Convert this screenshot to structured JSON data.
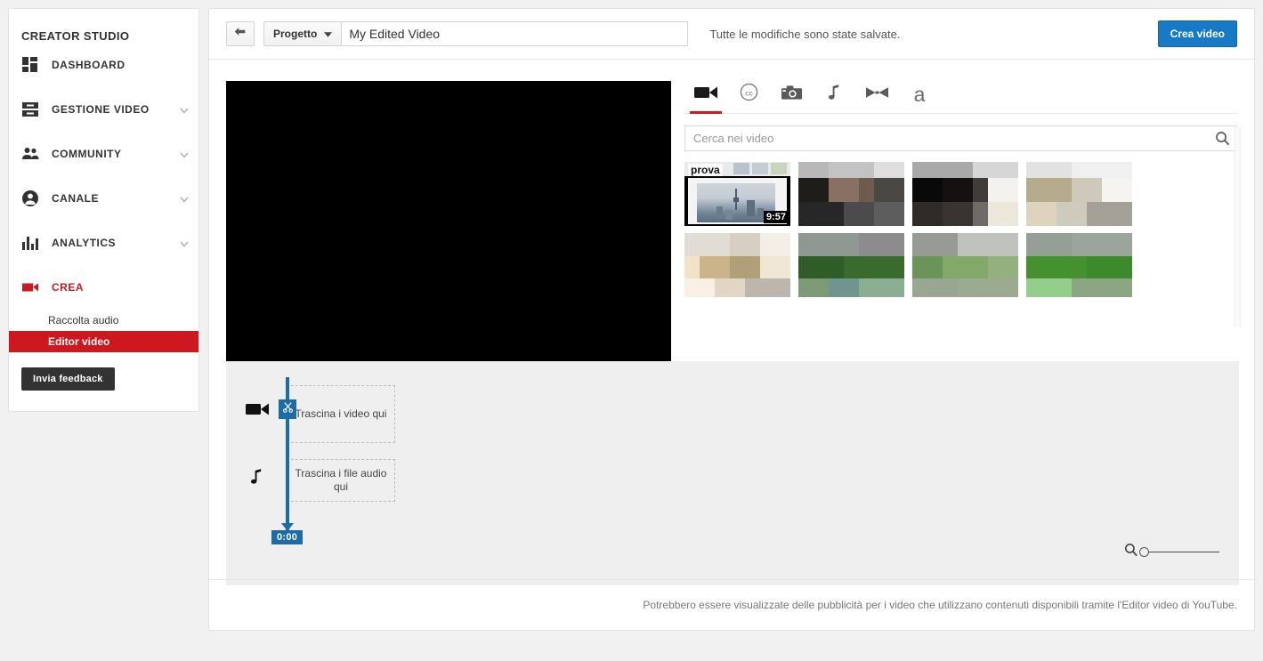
{
  "sidebar": {
    "title": "CREATOR STUDIO",
    "items": [
      {
        "label": "DASHBOARD",
        "icon": "dashboard-icon",
        "expandable": false,
        "active": false
      },
      {
        "label": "GESTIONE VIDEO",
        "icon": "video-manager-icon",
        "expandable": true,
        "active": false
      },
      {
        "label": "COMMUNITY",
        "icon": "people-icon",
        "expandable": true,
        "active": false
      },
      {
        "label": "CANALE",
        "icon": "account-circle-icon",
        "expandable": true,
        "active": false
      },
      {
        "label": "ANALYTICS",
        "icon": "bar-chart-icon",
        "expandable": true,
        "active": false
      },
      {
        "label": "CREA",
        "icon": "video-camera-icon",
        "expandable": false,
        "active": true
      }
    ],
    "sub_items": [
      {
        "label": "Raccolta audio",
        "selected": false
      },
      {
        "label": "Editor video",
        "selected": true
      }
    ],
    "feedback_label": "Invia feedback",
    "accent_color": "#cc181e"
  },
  "toolbar": {
    "back_icon": "back-arrow-icon",
    "project_label": "Progetto",
    "project_caret": "chevron-down-icon",
    "title_value": "My Edited Video",
    "title_placeholder": "Titolo progetto",
    "save_status": "Tutte le modifiche sono state salvate.",
    "create_label": "Crea video",
    "create_color": "#167ac6"
  },
  "library": {
    "tabs": [
      {
        "name": "video",
        "icon": "video-camera-icon",
        "active": true
      },
      {
        "name": "creative-commons",
        "icon": "cc-icon",
        "active": false
      },
      {
        "name": "photo",
        "icon": "camera-icon",
        "active": false
      },
      {
        "name": "audio",
        "icon": "music-note-icon",
        "active": false
      },
      {
        "name": "transition",
        "icon": "transition-icon",
        "active": false
      },
      {
        "name": "text",
        "icon": "text-a-icon",
        "active": false
      }
    ],
    "search_placeholder": "Cerca nei video",
    "search_value": "",
    "search_icon": "search-icon",
    "first_thumb_title": "prova",
    "first_thumb_duration": "9:57"
  },
  "timeline": {
    "video_track_icon": "video-camera-icon",
    "audio_track_icon": "music-note-icon",
    "video_dropzone_text": "Trascina i video qui",
    "audio_dropzone_text": "Trascina i file audio qui",
    "playhead_time": "0:00",
    "playhead_cut_icon": "scissors-icon",
    "playhead_color": "#1b6ca8",
    "zoom_icon": "search-icon",
    "zoom_value": 0
  },
  "footer": {
    "text": "Potrebbero essere visualizzate delle pubblicità per i video che utilizzano contenuti disponibili tramite l'Editor video di YouTube."
  }
}
